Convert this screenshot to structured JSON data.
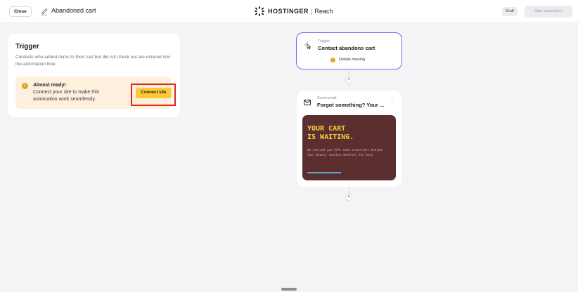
{
  "header": {
    "close_label": "Close",
    "title": "Abandoned cart",
    "brand": "HOSTINGER",
    "brand_separator": "|",
    "product": "Reach",
    "status_badge": "Draft",
    "start_label": "Start automation"
  },
  "trigger_panel": {
    "title": "Trigger",
    "description": "Contacts who added items to their cart but did not check out are entered into the automation flow.",
    "alert": {
      "icon": "!",
      "title": "Almost ready!",
      "text": "Connect your site to make this automation work seamlessly.",
      "button_label": "Connect site"
    }
  },
  "flow": {
    "trigger_card": {
      "subtitle": "Trigger",
      "title": "Contact abandons cart",
      "warning_icon": "!",
      "warning": "Details missing"
    },
    "plus_label": "+",
    "email_card": {
      "subtitle": "Send email",
      "title": "Forgot something? Your ...",
      "menu_icon": "⋮",
      "preview": {
        "headline_line1": "YOUR CART",
        "headline_line2": "IS WAITING.",
        "body": "We noticed you left some essentials behind. Your beauty routine deserves the best."
      }
    }
  },
  "colors": {
    "accent_border": "#7b67ee",
    "warning": "#e7a11d",
    "cta": "#ffc933",
    "highlight": "#e5231a",
    "preview_bg": "#5b2f2f",
    "preview_headline": "#f6d03e"
  }
}
